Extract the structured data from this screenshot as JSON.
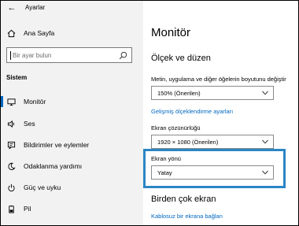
{
  "titlebar": {
    "back_icon": "back-arrow-icon",
    "title": "Ayarlar"
  },
  "sidebar": {
    "home": {
      "label": "Ana Sayfa",
      "icon": "home-icon"
    },
    "search": {
      "placeholder": "Bir ayar bulun",
      "icon": "search-icon"
    },
    "section_title": "Sistem",
    "items": [
      {
        "label": "Monitör",
        "icon": "monitor-icon",
        "selected": true
      },
      {
        "label": "Ses",
        "icon": "speaker-icon",
        "selected": false
      },
      {
        "label": "Bildirimler ve eylemler",
        "icon": "notification-icon",
        "selected": false
      },
      {
        "label": "Odaklanma yardımı",
        "icon": "moon-icon",
        "selected": false
      },
      {
        "label": "Güç ve uyku",
        "icon": "power-icon",
        "selected": false
      },
      {
        "label": "Pil",
        "icon": "battery-icon",
        "selected": false
      }
    ]
  },
  "main": {
    "title": "Monitör",
    "scale_section": {
      "heading": "Ölçek ve düzen",
      "text_size_label": "Metin, uygulama ve diğer öğelerin boyutunu değiştir",
      "text_size_value": "150% (Önerilen)",
      "advanced_link": "Gelişmiş ölçeklendirme ayarları",
      "resolution_label": "Ekran çözünürlüğü",
      "resolution_value": "1920 × 1080 (Önerilen)",
      "orientation_label": "Ekran yönü",
      "orientation_value": "Yatay"
    },
    "multi_section": {
      "heading": "Birden çok ekran",
      "wireless_link": "Kablosuz bir ekrana bağlan"
    }
  },
  "colors": {
    "accent": "#0067c0",
    "highlight_border": "#2b86c5",
    "sidebar_bg": "#f2f2f2"
  }
}
